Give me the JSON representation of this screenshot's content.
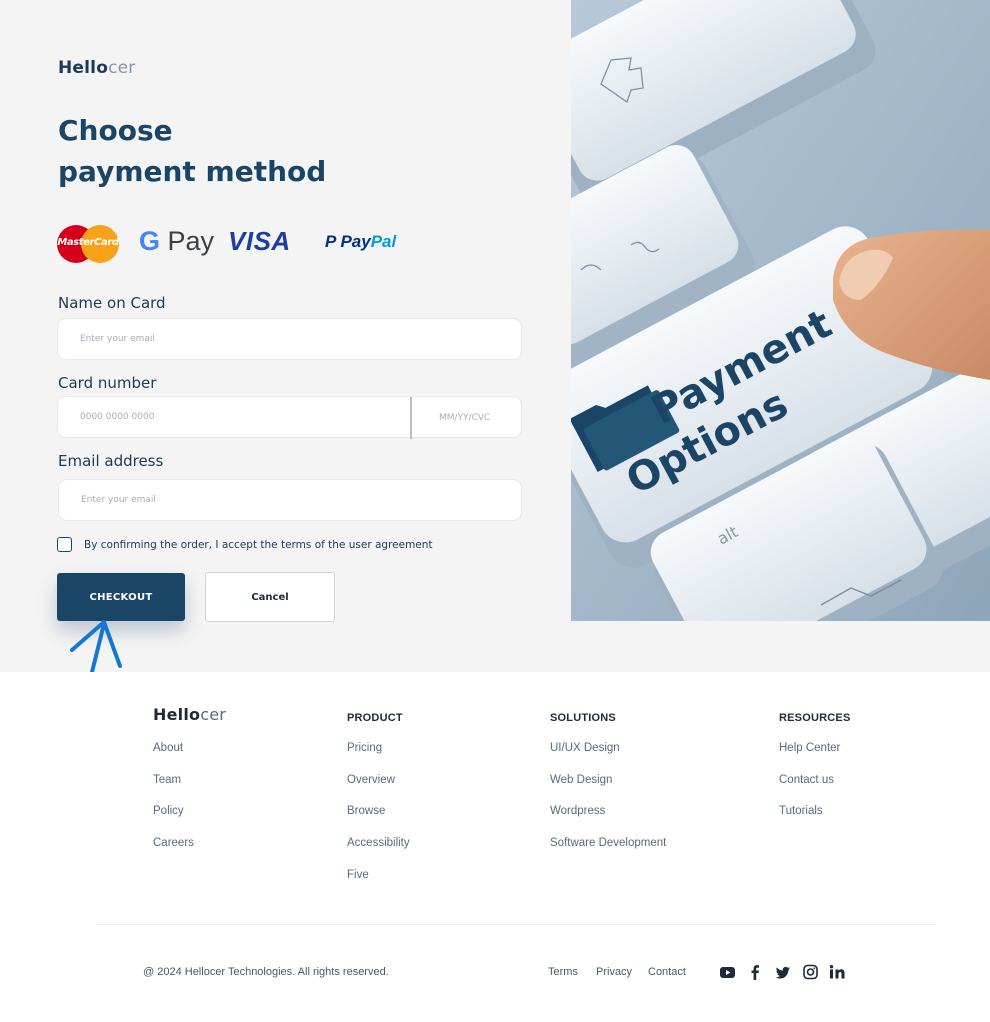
{
  "brand": {
    "bold": "Hello",
    "light": "cer"
  },
  "headline": {
    "line1": "Choose",
    "line2": "payment method"
  },
  "payment_methods": [
    {
      "name": "MasterCard",
      "icon": "mastercard-icon"
    },
    {
      "name": "G Pay",
      "icon": "google-pay-icon"
    },
    {
      "name": "VISA",
      "icon": "visa-icon"
    },
    {
      "name": "PayPal",
      "icon": "paypal-icon"
    }
  ],
  "form": {
    "name_label": "Name on Card",
    "name_placeholder": "Enter your email",
    "card_label": "Card  number",
    "card_placeholder": "0000 0000 0000",
    "expiry_placeholder": "MM/YY/CVC",
    "email_label": "Email address",
    "email_placeholder": "Enter your email",
    "agreement": "By confirming the order, I accept the terms of the user agreement",
    "checkout_label": "CHECKOUT",
    "cancel_label": "Cancel"
  },
  "hero_image": {
    "key_line1": "Payment",
    "key_line2": "Options",
    "key_small": "alt"
  },
  "footer": {
    "brand": {
      "bold": "Hello",
      "light": "cer"
    },
    "about_links": [
      "About",
      "Team",
      "Policy",
      "Careers"
    ],
    "product": {
      "title": "PRODUCT",
      "links": [
        "Pricing",
        "Overview",
        "Browse",
        "Accessibility",
        "Five"
      ]
    },
    "solutions": {
      "title": "SOLUTIONS",
      "links": [
        "UI/UX Design",
        "Web Design",
        "Wordpress",
        "Software Development"
      ]
    },
    "resources": {
      "title": "RESOURCES",
      "links": [
        "Help Center",
        "Contact us",
        "Tutorials"
      ]
    },
    "copyright": "@ 2024 Hellocer Technologies. All rights reserved.",
    "legal": {
      "terms": "Terms",
      "privacy": "Privacy",
      "contact": "Contact"
    },
    "social": [
      "youtube-icon",
      "facebook-icon",
      "twitter-icon",
      "instagram-icon",
      "linkedin-icon"
    ]
  },
  "colors": {
    "primary": "#1b4566",
    "background": "#f4f4f4",
    "annotation_arrow": "#1677d2"
  }
}
